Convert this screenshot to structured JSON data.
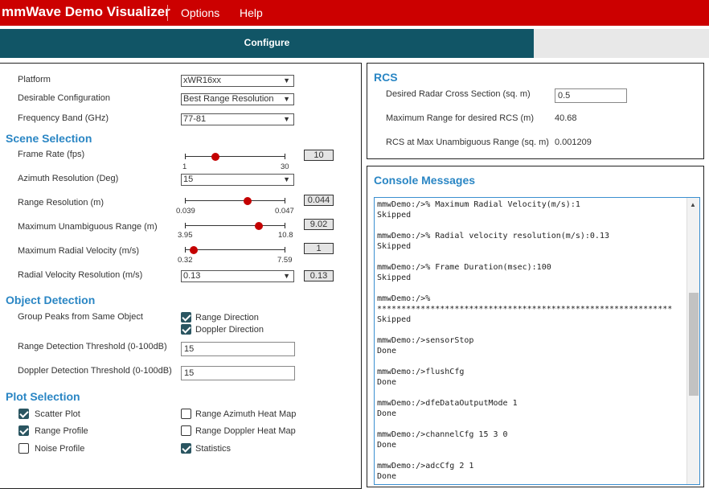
{
  "app": {
    "title": "mmWave Demo Visualizer"
  },
  "menu": {
    "items": [
      "Options",
      "Help"
    ]
  },
  "tabs": {
    "configure": "Configure"
  },
  "setup": {
    "platform": {
      "label": "Platform",
      "value": "xWR16xx"
    },
    "desirable_config": {
      "label": "Desirable Configuration",
      "value": "Best Range Resolution"
    },
    "frequency_band": {
      "label": "Frequency Band (GHz)",
      "value": "77-81"
    }
  },
  "scene": {
    "title": "Scene Selection",
    "frame_rate": {
      "label": "Frame Rate (fps)",
      "min": "1",
      "max": "30",
      "value": "10",
      "fraction": 0.31
    },
    "azimuth_resolution": {
      "label": "Azimuth Resolution (Deg)",
      "value": "15"
    },
    "range_resolution": {
      "label": "Range Resolution (m)",
      "min": "0.039",
      "max": "0.047",
      "value": "0.044",
      "fraction": 0.63
    },
    "max_unambiguous_range": {
      "label": "Maximum Unambiguous Range (m)",
      "min": "3.95",
      "max": "10.8",
      "value": "9.02",
      "fraction": 0.74
    },
    "max_radial_velocity": {
      "label": "Maximum Radial Velocity (m/s)",
      "min": "0.32",
      "max": "7.59",
      "value": "1",
      "fraction": 0.09
    },
    "radial_velocity_resolution": {
      "label": "Radial Velocity Resolution (m/s)",
      "value": "0.13",
      "box": "0.13"
    }
  },
  "object_detection": {
    "title": "Object Detection",
    "group_peaks": {
      "label": "Group Peaks from Same Object",
      "range_direction": "Range Direction",
      "doppler_direction": "Doppler Direction",
      "range_checked": true,
      "doppler_checked": true
    },
    "range_threshold": {
      "label": "Range Detection Threshold (0-100dB)",
      "value": "15"
    },
    "doppler_threshold": {
      "label": "Doppler Detection Threshold (0-100dB)",
      "value": "15"
    }
  },
  "plot_selection": {
    "title": "Plot Selection",
    "scatter_plot": {
      "label": "Scatter Plot",
      "checked": true
    },
    "range_profile": {
      "label": "Range Profile",
      "checked": true
    },
    "noise_profile": {
      "label": "Noise Profile",
      "checked": false
    },
    "range_azimuth_heat_map": {
      "label": "Range Azimuth Heat Map",
      "checked": false
    },
    "range_doppler_heat_map": {
      "label": "Range Doppler Heat Map",
      "checked": false
    },
    "statistics": {
      "label": "Statistics",
      "checked": true
    }
  },
  "rcs": {
    "title": "RCS",
    "desired_rcs": {
      "label": "Desired Radar Cross Section (sq. m)",
      "value": "0.5"
    },
    "max_range": {
      "label": "Maximum Range for desired RCS (m)",
      "value": "40.68"
    },
    "rcs_at_max_range": {
      "label": "RCS at Max Unambiguous Range (sq. m)",
      "value": "0.001209"
    }
  },
  "console": {
    "title": "Console Messages",
    "lines": [
      "mmwDemo:/>% Maximum Radial Velocity(m/s):1",
      "Skipped",
      "",
      "mmwDemo:/>% Radial velocity resolution(m/s):0.13",
      "Skipped",
      "",
      "mmwDemo:/>% Frame Duration(msec):100",
      "Skipped",
      "",
      "mmwDemo:/>%",
      "*************************************************************",
      "Skipped",
      "",
      "mmwDemo:/>sensorStop",
      "Done",
      "",
      "mmwDemo:/>flushCfg",
      "Done",
      "",
      "mmwDemo:/>dfeDataOutputMode 1",
      "Done",
      "",
      "mmwDemo:/>channelCfg 15 3 0",
      "Done",
      "",
      "mmwDemo:/>adcCfg 2 1",
      "Done"
    ]
  },
  "icons": {
    "dropdown": "chevron-down-icon",
    "checkbox": "check-icon",
    "scroll_up": "scroll-up-arrow-icon"
  },
  "colors": {
    "topbar": "#cc0000",
    "configure_tab": "#115566",
    "section_title": "#2a86c4",
    "slider_knob": "#c40000",
    "checkbox_checked": "#2a5561"
  }
}
